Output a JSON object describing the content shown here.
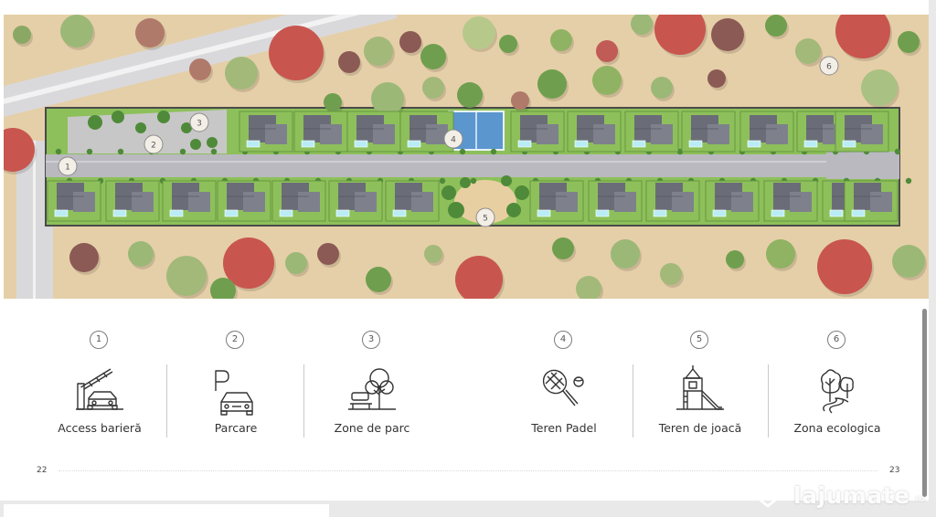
{
  "features": [
    {
      "number": "1",
      "label": "Access barieră",
      "icon": "barrier-gate-icon"
    },
    {
      "number": "2",
      "label": "Parcare",
      "icon": "parking-car-icon"
    },
    {
      "number": "3",
      "label": "Zone de parc",
      "icon": "park-bench-tree-icon"
    },
    {
      "number": "4",
      "label": "Teren Padel",
      "icon": "padel-racket-icon"
    },
    {
      "number": "5",
      "label": "Teren de joacă",
      "icon": "playground-slide-icon"
    },
    {
      "number": "6",
      "label": "Zona ecologica",
      "icon": "eco-trees-path-icon"
    }
  ],
  "map_markers": [
    "1",
    "2",
    "3",
    "4",
    "5",
    "6"
  ],
  "page_numbers": {
    "left": "22",
    "right": "23"
  },
  "watermark": {
    "brand": "lajumate",
    "tld": ".ro"
  },
  "colors": {
    "terrain": "#e8d3ad",
    "lawn": "#8dc05a",
    "road": "#b9b9bf",
    "roof": "#6a6d78",
    "pool": "#b9ecf4",
    "padel_court": "#5b96cf",
    "text": "#333333"
  }
}
